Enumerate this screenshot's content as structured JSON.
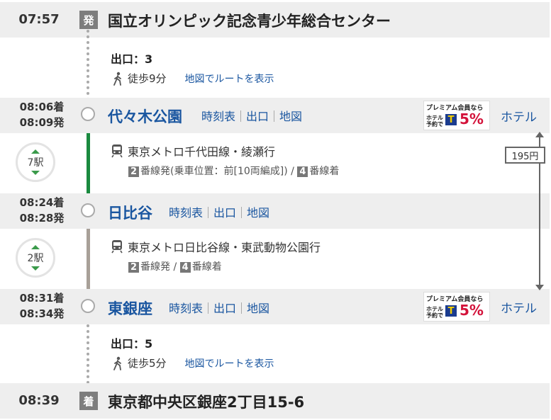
{
  "departure": {
    "time": "07:57",
    "badge": "発",
    "place": "国立オリンピック記念青少年総合センター"
  },
  "exit1": {
    "label": "出口：3",
    "walk": "徒歩9分",
    "map_route": "地図でルートを表示"
  },
  "station1": {
    "arrive": "08:06着",
    "depart": "08:09発",
    "name": "代々木公園",
    "links": [
      "時刻表",
      "出口",
      "地図"
    ],
    "hotel": "ホテル"
  },
  "segment1": {
    "stops": "7駅",
    "line": "東京メトロ千代田線・綾瀬行",
    "dep_track": "2",
    "dep_text": "番線発(乗車位置：前[10両編成]) / ",
    "arr_track": "4",
    "arr_text": "番線着",
    "line_color": "#1a8a3f"
  },
  "station2": {
    "arrive": "08:24着",
    "depart": "08:28発",
    "name": "日比谷",
    "links": [
      "時刻表",
      "出口",
      "地図"
    ]
  },
  "segment2": {
    "stops": "2駅",
    "line": "東京メトロ日比谷線・東武動物公園行",
    "dep_track": "2",
    "dep_text": "番線発 / ",
    "arr_track": "4",
    "arr_text": "番線着",
    "line_color": "#a8a098"
  },
  "station3": {
    "arrive": "08:31着",
    "depart": "08:34発",
    "name": "東銀座",
    "links": [
      "時刻表",
      "出口",
      "地図"
    ],
    "hotel": "ホテル"
  },
  "exit2": {
    "label": "出口：5",
    "walk": "徒歩5分",
    "map_route": "地図でルートを表示"
  },
  "arrival": {
    "time": "08:39",
    "badge": "着",
    "place": "東京都中央区銀座2丁目15-6"
  },
  "fare": "195円",
  "promo": {
    "headline": "プレミアム会員なら",
    "hotel_booking": "ホテル予約で",
    "t_logo": "T",
    "percent": "5%"
  }
}
